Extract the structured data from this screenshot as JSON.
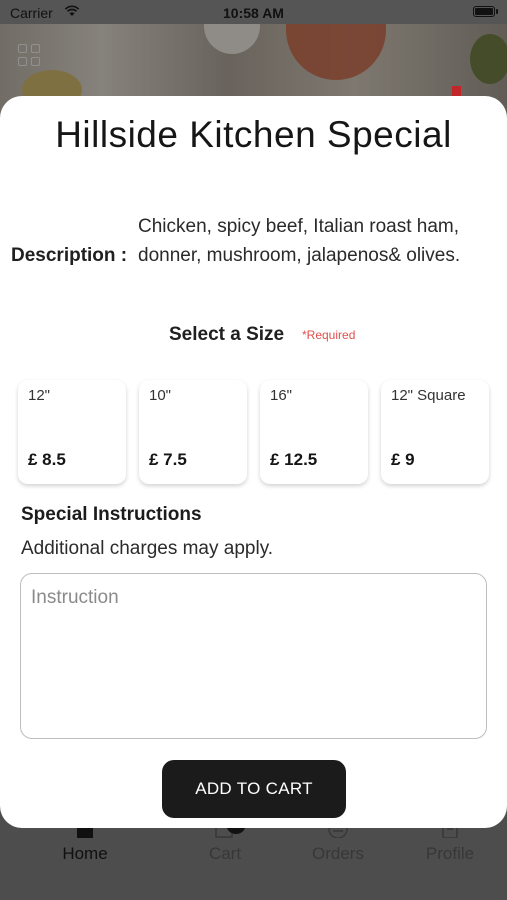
{
  "status_bar": {
    "carrier": "Carrier",
    "time": "10:58 AM"
  },
  "modal": {
    "title": "Hillside Kitchen Special",
    "description_label": "Description :",
    "description": "Chicken, spicy beef, Italian roast ham, donner, mushroom, jalapenos& olives.",
    "size_heading": "Select a Size",
    "size_required": "*Required",
    "sizes": [
      {
        "name": "12\"",
        "price": "£ 8.5"
      },
      {
        "name": "10\"",
        "price": "£ 7.5"
      },
      {
        "name": "16\"",
        "price": "£ 12.5"
      },
      {
        "name": "12\" Square",
        "price": "£ 9"
      }
    ],
    "special_instructions_heading": "Special Instructions",
    "special_instructions_note": "Additional charges may apply.",
    "instruction_placeholder": "Instruction",
    "add_to_cart": "ADD TO CART"
  },
  "tabbar": {
    "tabs": [
      {
        "label": "Home",
        "icon": "home-icon",
        "active": true
      },
      {
        "label": "Cart",
        "icon": "cart-icon",
        "badge": "0"
      },
      {
        "label": "Orders",
        "icon": "orders-icon"
      },
      {
        "label": "Profile",
        "icon": "profile-icon"
      }
    ]
  }
}
